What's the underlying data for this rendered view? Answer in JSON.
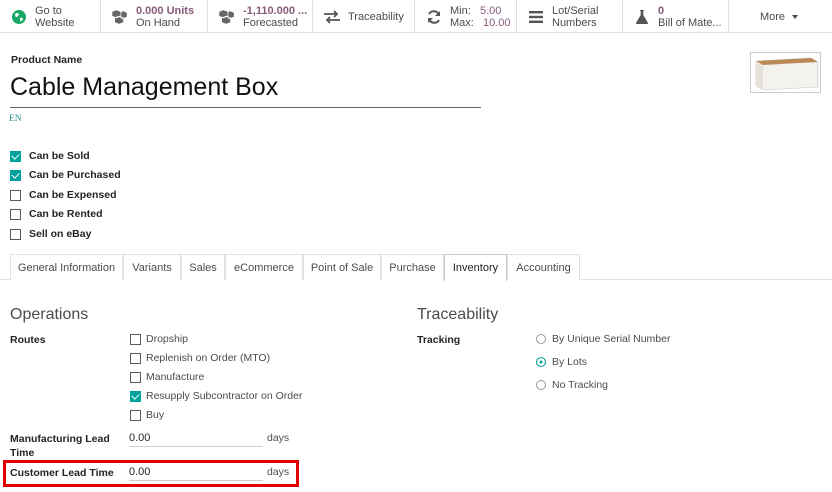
{
  "smart_buttons": [
    {
      "icon": "globe-icon",
      "line1": "Go to",
      "line2": "Website"
    },
    {
      "icon": "cubes-icon",
      "line1": "0.000 Units",
      "line2": "On Hand"
    },
    {
      "icon": "cubes-icon",
      "line1": "-1,110.000 ...",
      "line2": "Forecasted"
    },
    {
      "icon": "arrows-exchange-icon",
      "line1": "Traceability"
    },
    {
      "icon": "refresh-icon",
      "min_label": "Min:",
      "min_value": "5.00",
      "max_label": "Max:",
      "max_value": "10.00"
    },
    {
      "icon": "list-icon",
      "line1": "Lot/Serial",
      "line2": "Numbers"
    },
    {
      "icon": "flask-icon",
      "line1": "0",
      "line2": "Bill of Mate..."
    },
    {
      "label": "More"
    }
  ],
  "product": {
    "name_label": "Product Name",
    "name": "Cable Management Box",
    "lang": "EN"
  },
  "flags": [
    {
      "label": "Can be Sold",
      "checked": true
    },
    {
      "label": "Can be Purchased",
      "checked": true
    },
    {
      "label": "Can be Expensed",
      "checked": false
    },
    {
      "label": "Can be Rented",
      "checked": false
    },
    {
      "label": "Sell on eBay",
      "checked": false
    }
  ],
  "tabs": [
    "General Information",
    "Variants",
    "Sales",
    "eCommerce",
    "Point of Sale",
    "Purchase",
    "Inventory",
    "Accounting"
  ],
  "active_tab": "Inventory",
  "operations": {
    "title": "Operations",
    "routes_label": "Routes",
    "routes": [
      {
        "label": "Dropship",
        "checked": false
      },
      {
        "label": "Replenish on Order (MTO)",
        "checked": false
      },
      {
        "label": "Manufacture",
        "checked": false
      },
      {
        "label": "Resupply Subcontractor on Order",
        "checked": true
      },
      {
        "label": "Buy",
        "checked": false
      }
    ],
    "mfg_lead_label_1": "Manufacturing Lead",
    "mfg_lead_label_2": "Time",
    "mfg_lead_value": "0.00",
    "mfg_lead_unit": "days",
    "cust_lead_label": "Customer Lead Time",
    "cust_lead_value": "0.00",
    "cust_lead_unit": "days"
  },
  "traceability": {
    "title": "Traceability",
    "tracking_label": "Tracking",
    "options": [
      {
        "label": "By Unique Serial Number",
        "selected": false
      },
      {
        "label": "By Lots",
        "selected": true
      },
      {
        "label": "No Tracking",
        "selected": false
      }
    ]
  },
  "colors": {
    "accent": "#00a09d",
    "brand": "#875a7b",
    "highlight": "#e00000"
  }
}
